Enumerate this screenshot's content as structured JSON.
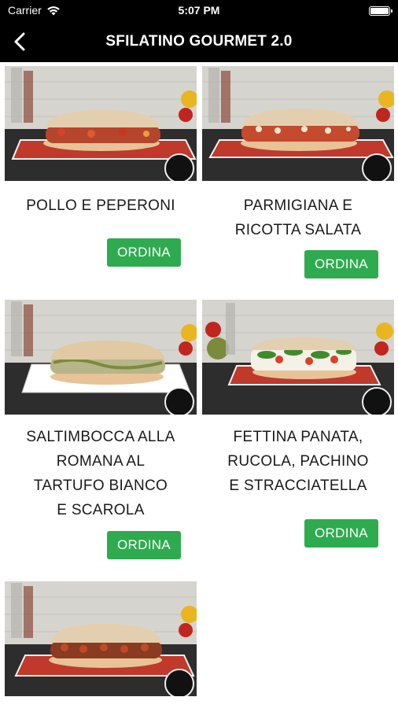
{
  "status_bar": {
    "carrier": "Carrier",
    "time": "5:07 PM"
  },
  "nav": {
    "title": "SFILATINO GOURMET 2.0"
  },
  "items": [
    {
      "name": "POLLO E PEPERONI",
      "button": "ORDINA"
    },
    {
      "name": "PARMIGIANA E\nRICOTTA SALATA",
      "button": "ORDINA"
    },
    {
      "name": "SALTIMBOCCA ALLA\nROMANA AL\nTARTUFO BIANCO\nE SCAROLA",
      "button": "ORDINA"
    },
    {
      "name": "FETTINA PANATA,\nRUCOLA, PACHINO\nE STRACCIATELLA",
      "button": "ORDINA"
    },
    {
      "name": "",
      "button": ""
    }
  ],
  "colors": {
    "header_bg": "#000000",
    "button_bg": "#2eab4f",
    "text": "#1a1a1a"
  },
  "icons": {
    "back": "chevron-left-icon",
    "wifi": "wifi-icon",
    "battery": "battery-icon"
  }
}
